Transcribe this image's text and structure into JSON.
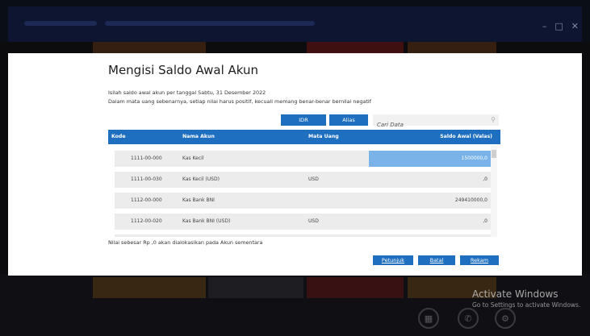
{
  "dialog": {
    "title": "Mengisi Saldo Awal Akun",
    "description_1": "Isilah saldo awal akun per tanggal Sabtu, 31 Desember 2022",
    "description_2": "Dalam mata uang sebenarnya, setiap nilai harus positif, kecuali memang benar-benar bernilai negatif",
    "toolbar": {
      "idr_label": "IDR",
      "alias_label": "Alias",
      "search_placeholder": "Cari Data"
    },
    "table": {
      "headers": {
        "code": "Kode",
        "name": "Nama Akun",
        "currency": "Mata Uang",
        "balance": "Saldo Awal (Valas)"
      },
      "rows": [
        {
          "code": "1111-00-000",
          "name": "Kas Kecil",
          "currency": "",
          "balance": "1500000,0",
          "active": true
        },
        {
          "code": "1111-00-030",
          "name": "Kas Kecil (USD)",
          "currency": "USD",
          "balance": ",0"
        },
        {
          "code": "1112-00-000",
          "name": "Kas Bank BNI",
          "currency": "",
          "balance": "249410000,0"
        },
        {
          "code": "1112-00-020",
          "name": "Kas Bank BNI (USD)",
          "currency": "USD",
          "balance": ",0"
        }
      ]
    },
    "footer_note": "Nilai sebesar Rp ,0 akan dialokasikan pada Akun sementara",
    "buttons": {
      "help": "Petunjuk",
      "cancel": "Batal",
      "save": "Rekam"
    }
  },
  "watermark": {
    "title": "Activate Windows",
    "subtitle": "Go to Settings to activate Windows."
  },
  "colors": {
    "accent": "#1e6fbf",
    "active_cell": "#79b3e8",
    "row_bg": "#ececec"
  }
}
